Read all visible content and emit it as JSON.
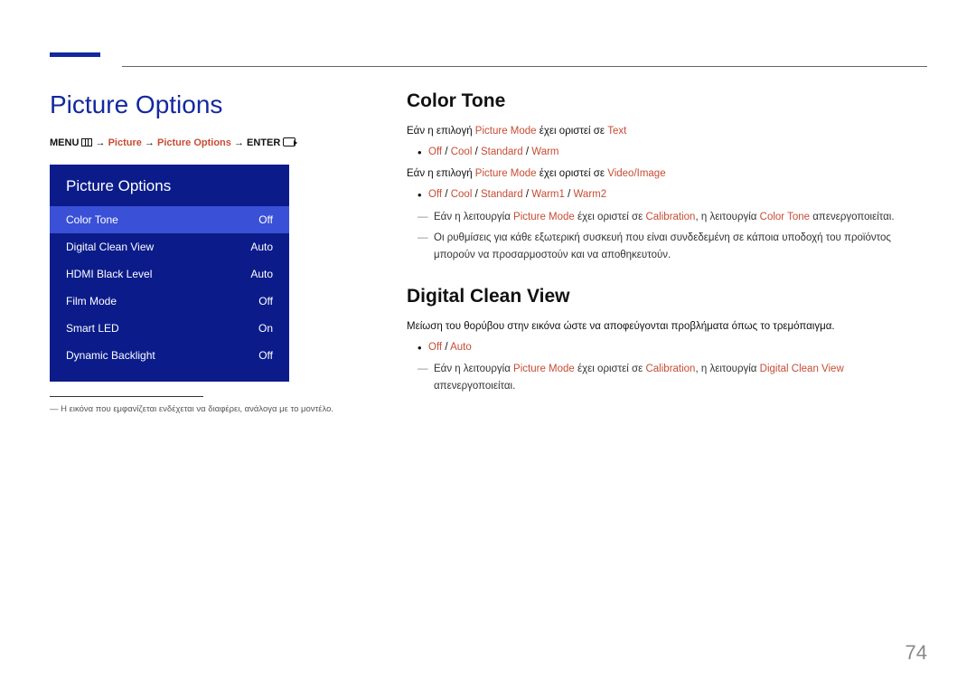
{
  "page_number": "74",
  "left": {
    "title": "Picture Options",
    "breadcrumb": {
      "menu": "MENU",
      "arrow": "→",
      "seg1": "Picture",
      "seg2": "Picture Options",
      "enter": "ENTER"
    },
    "tvmenu": {
      "header": "Picture Options",
      "rows": [
        {
          "label": "Color Tone",
          "value": "Off",
          "selected": true
        },
        {
          "label": "Digital Clean View",
          "value": "Auto",
          "selected": false
        },
        {
          "label": "HDMI Black Level",
          "value": "Auto",
          "selected": false
        },
        {
          "label": "Film Mode",
          "value": "Off",
          "selected": false
        },
        {
          "label": "Smart LED",
          "value": "On",
          "selected": false
        },
        {
          "label": "Dynamic Backlight",
          "value": "Off",
          "selected": false
        }
      ]
    },
    "disclaimer_prefix": "―",
    "disclaimer": "Η εικόνα που εμφανίζεται ενδέχεται να διαφέρει, ανάλογα με το μοντέλο."
  },
  "right": {
    "color_tone": {
      "heading": "Color Tone",
      "line1": {
        "pre": "Εάν η επιλογή ",
        "pm": "Picture Mode",
        "mid": " έχει οριστεί σε ",
        "val": "Text"
      },
      "opts1": {
        "a": "Off",
        "b": "Cool",
        "c": "Standard",
        "d": "Warm"
      },
      "line2": {
        "pre": "Εάν η επιλογή ",
        "pm": "Picture Mode",
        "mid": " έχει οριστεί σε ",
        "val": "Video/Image"
      },
      "opts2": {
        "a": "Off",
        "b": "Cool",
        "c": "Standard",
        "d": "Warm1",
        "e": "Warm2"
      },
      "note1": {
        "pre": "Εάν η λειτουργία ",
        "pm": "Picture Mode",
        "mid": " έχει οριστεί σε ",
        "cal": "Calibration",
        "mid2": ", η λειτουργία ",
        "ct": "Color Tone",
        "post": " απενεργοποιείται."
      },
      "note2": "Οι ρυθμίσεις για κάθε εξωτερική συσκευή που είναι συνδεδεμένη σε κάποια υποδοχή του προϊόντος μπορούν να προσαρμοστούν και να αποθηκευτούν."
    },
    "dcv": {
      "heading": "Digital Clean View",
      "desc": "Μείωση του θορύβου στην εικόνα ώστε να αποφεύγονται προβλήματα όπως το τρεμόπαιγμα.",
      "opts": {
        "a": "Off",
        "b": "Auto"
      },
      "note": {
        "pre": "Εάν η λειτουργία ",
        "pm": "Picture Mode",
        "mid": " έχει οριστεί σε ",
        "cal": "Calibration",
        "mid2": ", η λειτουργία ",
        "dcv": "Digital Clean View",
        "post": " απενεργοποιείται."
      }
    }
  }
}
